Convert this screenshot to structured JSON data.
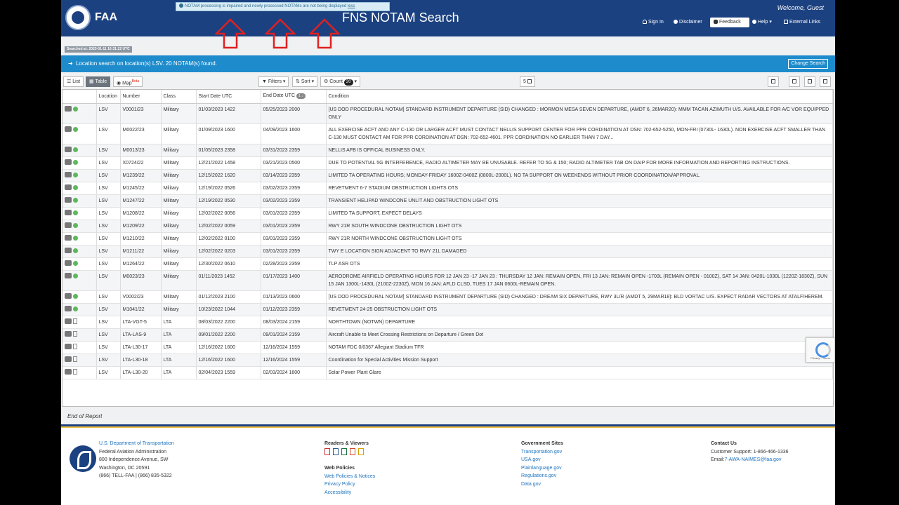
{
  "header": {
    "brand": "FAA",
    "alert_text": "NOTAM processing is impaired and newly processed NOTAMs are not being displayed",
    "alert_link": "less",
    "title": "FNS NOTAM Search",
    "welcome": "Welcome, Guest",
    "nav": {
      "sign_in": "Sign In",
      "disclaimer": "Disclaimer",
      "feedback": "Feedback",
      "help": "Help ▾",
      "external_links": "External Links"
    }
  },
  "search_stamp": "Searched at: 2023-01-11 16:31:22 UTC",
  "banner": {
    "text": "Location search on location(s) LSV. 20 NOTAM(s) found.",
    "change_search": "Change Search"
  },
  "toolbar": {
    "list": "List",
    "table": "Table",
    "map": "Map",
    "map_badge": "Beta",
    "filters": "Filters",
    "sort": "Sort",
    "count": "Count",
    "count_value": "20",
    "page_count": "5"
  },
  "table": {
    "headers": [
      "",
      "Location",
      "Number",
      "Class",
      "Start Date UTC",
      "End Date UTC",
      "Condition"
    ],
    "end_sort_badge": "1 ↓",
    "rows": [
      {
        "loc": "LSV",
        "num": "V0001/23",
        "cls": "Military",
        "start": "01/03/2023 1422",
        "end": "05/25/2023 2000",
        "cond": "[US DOD PROCEDURAL NOTAM] STANDARD INSTRUMENT DEPARTURE (SID) CHANGED : MORMON MESA SEVEN DEPARTURE, (AMDT 6, 26MAR20): MMM TACAN AZIMUTH U/S. AVAILABLE FOR A/C VOR EQUIPPED ONLY",
        "icon": "dot"
      },
      {
        "loc": "LSV",
        "num": "M0022/23",
        "cls": "Military",
        "start": "01/09/2023 1600",
        "end": "04/09/2023 1600",
        "cond": "ALL EXERCISE ACFT AND ANY C-130 OR LARGER ACFT MUST CONTACT NELLIS SUPPORT CENTER FOR PPR CORDINATION AT DSN: 702-652-5250, MON-FRI (0730L- 1630L). NON EXERCISE ACFT SMALLER THAN C-130 MUST CONTACT AM FOR PPR CORDINATION AT DSN: 702-652-4601. PPR CORDINATION NO EARLIER THAN 7 DAY...",
        "icon": "dot"
      },
      {
        "loc": "LSV",
        "num": "M0013/23",
        "cls": "Military",
        "start": "01/05/2023 2358",
        "end": "03/31/2023 2359",
        "cond": "NELLIS AFB IS OFFICAL BUSINESS ONLY.",
        "icon": "dot"
      },
      {
        "loc": "LSV",
        "num": "X0724/22",
        "cls": "Military",
        "start": "12/21/2022 1458",
        "end": "03/21/2023 0500",
        "cond": "DUE TO POTENTIAL 5G INTERFERENCE, RADIO ALTIMETER MAY BE UNUSABLE. REFER TO 5G & 150; RADIO ALTIMETER TAB ON DAIP FOR MORE INFORMATION AND REPORTING INSTRUCTIONS.",
        "icon": "dot"
      },
      {
        "loc": "LSV",
        "num": "M1239/22",
        "cls": "Military",
        "start": "12/15/2022 1620",
        "end": "03/14/2023 2359",
        "cond": "LIMITED TA OPERATING HOURS; MONDAY-FRIDAY 1600Z-0400Z (0800L-2000L). NO TA SUPPORT ON WEEKENDS WITHOUT PRIOR COORDINATION/APPROVAL.",
        "icon": "dot"
      },
      {
        "loc": "LSV",
        "num": "M1245/22",
        "cls": "Military",
        "start": "12/19/2022 0526",
        "end": "03/02/2023 2359",
        "cond": "REVETMENT 6-7 STADIUM OBSTRUCTION LIGHTS OTS",
        "icon": "dot"
      },
      {
        "loc": "LSV",
        "num": "M1247/22",
        "cls": "Military",
        "start": "12/19/2022 0530",
        "end": "03/02/2023 2359",
        "cond": "TRANSIENT HELIPAD WINDCONE UNLIT AND OBSTRUCTION LIGHT OTS",
        "icon": "dot"
      },
      {
        "loc": "LSV",
        "num": "M1208/22",
        "cls": "Military",
        "start": "12/02/2022 0056",
        "end": "03/01/2023 2359",
        "cond": "LIMITED TA SUPPORT, EXPECT DELAYS",
        "icon": "dot"
      },
      {
        "loc": "LSV",
        "num": "M1209/22",
        "cls": "Military",
        "start": "12/02/2022 0059",
        "end": "03/01/2023 2359",
        "cond": "RWY 21R SOUTH WINDCONE OBSTRUCTION LIGHT OTS",
        "icon": "dot"
      },
      {
        "loc": "LSV",
        "num": "M1210/22",
        "cls": "Military",
        "start": "12/02/2022 0100",
        "end": "03/01/2023 2359",
        "cond": "RWY 21R NORTH WINDCONE OBSTRUCTION LIGHT OTS",
        "icon": "dot"
      },
      {
        "loc": "LSV",
        "num": "M1211/22",
        "cls": "Military",
        "start": "12/02/2022 0203",
        "end": "03/01/2023 2359",
        "cond": "TWY E LOCATION SIGN ADJACENT TO RWY 21L DAMAGED",
        "icon": "dot"
      },
      {
        "loc": "LSV",
        "num": "M1264/22",
        "cls": "Military",
        "start": "12/30/2022 0610",
        "end": "02/28/2023 2359",
        "cond": "TLP ASR OTS",
        "icon": "dot"
      },
      {
        "loc": "LSV",
        "num": "M0023/23",
        "cls": "Military",
        "start": "01/11/2023 1452",
        "end": "01/17/2023 1400",
        "cond": "AERODROME AIRFIELD OPERATING HOURS FOR 12 JAN 23 -17 JAN 23 : THURSDAY 12 JAN: REMAIN OPEN, FRI 13 JAN: REMAIN OPEN -1700L (REMAIN OPEN - 0100Z), SAT 14 JAN: 0420L-1030L (1220Z-1830Z), SUN 15 JAN 1300L-1430L (2100Z-2230Z), MON 16 JAN: AFLD CLSD, TUES 17 JAN 0600L-REMAIN OPEN.",
        "icon": "dot"
      },
      {
        "loc": "LSV",
        "num": "V0002/23",
        "cls": "Military",
        "start": "01/12/2023 2100",
        "end": "01/13/2023 0600",
        "cond": "[US DOD PROCEDURAL NOTAM] STANDARD INSTRUMENT DEPARTURE (SID) CHANGED : DREAM SIX DEPARTURE, RWY 3L/R (AMDT 5, 29MAR18): BLD VORTAC U/S. EXPECT RADAR VECTORS AT ATALF/HEREM.",
        "icon": "dot"
      },
      {
        "loc": "LSV",
        "num": "M1041/22",
        "cls": "Military",
        "start": "10/23/2022 1044",
        "end": "01/12/2023 2359",
        "cond": "REVETMENT 24-25 OBSTRUCTION LIGHT OTS",
        "icon": "dot"
      },
      {
        "loc": "LSV",
        "num": "LTA-VGT-5",
        "cls": "LTA",
        "start": "08/03/2022 2200",
        "end": "08/03/2024 2159",
        "cond": "NORTHTOWN (NOTWN) DEPARTURE",
        "icon": "file"
      },
      {
        "loc": "LSV",
        "num": "LTA-LAS-9",
        "cls": "LTA",
        "start": "09/01/2022 2200",
        "end": "09/01/2024 2159",
        "cond": "Aircraft Unable to Meet Crossing Restrictions on Departure / Green Dot",
        "icon": "file"
      },
      {
        "loc": "LSV",
        "num": "LTA-L30-17",
        "cls": "LTA",
        "start": "12/16/2022 1600",
        "end": "12/16/2024 1559",
        "cond": "NOTAM FDC 0/0367 Allegiant Stadium TFR",
        "icon": "file"
      },
      {
        "loc": "LSV",
        "num": "LTA-L30-18",
        "cls": "LTA",
        "start": "12/16/2022 1600",
        "end": "12/16/2024 1559",
        "cond": "Coordination for Special Activities Mission Support",
        "icon": "file"
      },
      {
        "loc": "LSV",
        "num": "LTA-L30-20",
        "cls": "LTA",
        "start": "02/04/2023 1559",
        "end": "02/03/2024 1600",
        "cond": "Solar Power Plant Glare",
        "icon": "file"
      }
    ]
  },
  "recaptcha": "Privacy - Terms",
  "end_of_report": "End of Report",
  "footer": {
    "dot": {
      "link": "U.S. Department of Transportation",
      "line1": "Federal Aviation Administration",
      "line2": "800 Independence Avenue, SW",
      "line3": "Washington, DC 20591",
      "line4": "(866) TELL-FAA | (866) 835-5322"
    },
    "readers_title": "Readers & Viewers",
    "web_policies_title": "Web Policies",
    "web_policies": [
      "Web Policies & Notices",
      "Privacy Policy",
      "Accessibility"
    ],
    "gov_sites_title": "Government Sites",
    "gov_sites": [
      "Transportation.gov",
      "USA.gov",
      "Plainlanguage.gov",
      "Regulations.gov",
      "Data.gov"
    ],
    "contact_title": "Contact Us",
    "customer_support": "Customer Support: 1-866-466-1336",
    "email_label": "Email:",
    "email": "7-AWA-NAIMES@faa.gov"
  },
  "colors": {
    "header_blue": "#1c4180",
    "banner_blue": "#1e8ccc",
    "arrow_red": "#e02020",
    "status_green": "#5cb85c"
  }
}
